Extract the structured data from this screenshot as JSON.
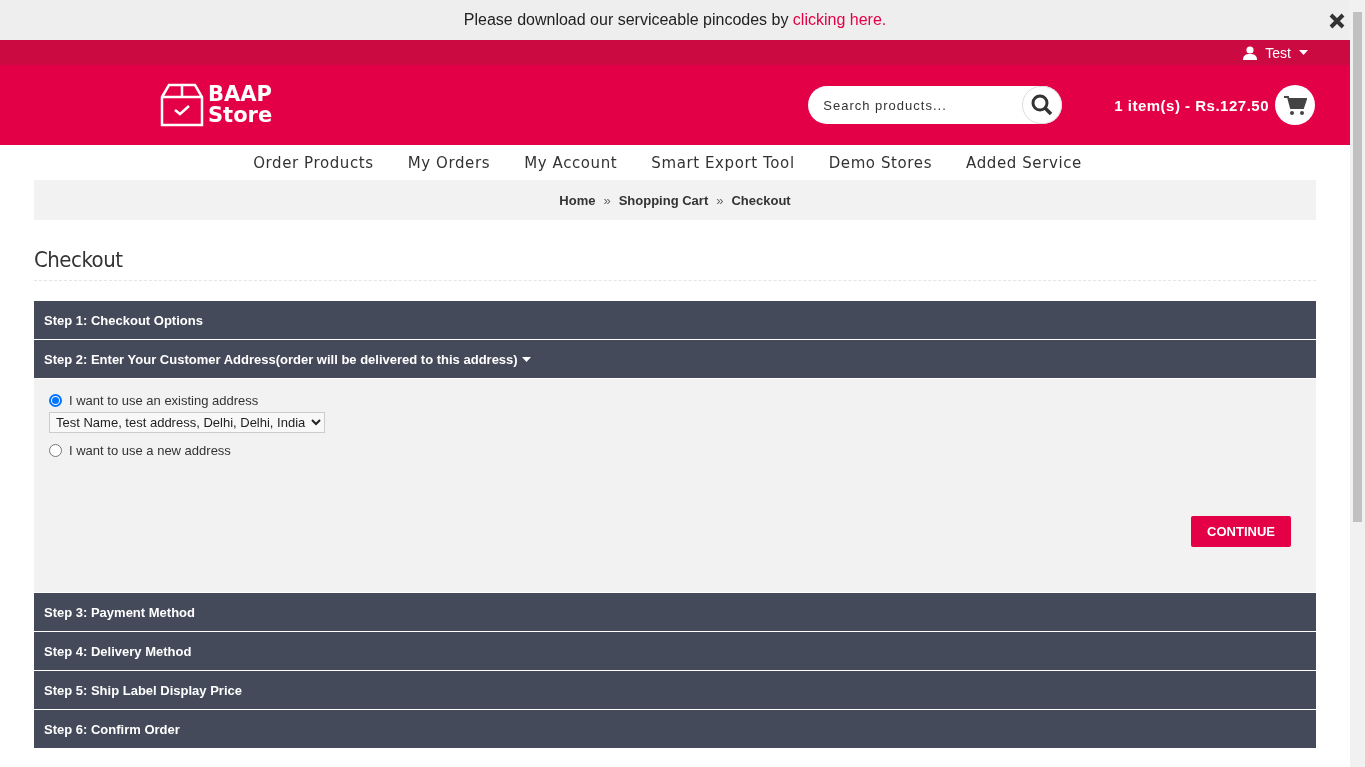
{
  "banner": {
    "text": "Please download our serviceable pincodes by ",
    "link": "clicking here."
  },
  "header": {
    "user": "Test",
    "logo": {
      "line1": "BAAP",
      "line2": "Store"
    },
    "search": {
      "placeholder": "Search products..."
    },
    "cart": "1 item(s) - Rs.127.50"
  },
  "nav": [
    "Order Products",
    "My Orders",
    "My Account",
    "Smart Export Tool",
    "Demo Stores",
    "Added Service"
  ],
  "breadcrumb": [
    "Home",
    "Shopping Cart",
    "Checkout"
  ],
  "breadcrumb_separator": "»",
  "page_title": "Checkout",
  "steps": [
    {
      "title": "Step 1: Checkout Options",
      "expanded": false
    },
    {
      "title": "Step 2: Enter Your Customer Address(order will be delivered to this address)",
      "expanded": true,
      "options": [
        {
          "kind": "radio",
          "label": "I want to use an existing address",
          "selected": true
        },
        {
          "kind": "select",
          "value": "Test Name, test address, Delhi, Delhi, India"
        },
        {
          "kind": "radio",
          "label": "I want to use a new address",
          "selected": false
        }
      ],
      "button": "CONTINUE"
    },
    {
      "title": "Step 3: Payment Method",
      "expanded": false
    },
    {
      "title": "Step 4: Delivery Method",
      "expanded": false
    },
    {
      "title": "Step 5: Ship Label Display Price",
      "expanded": false
    },
    {
      "title": "Step 6: Confirm Order",
      "expanded": false
    }
  ]
}
